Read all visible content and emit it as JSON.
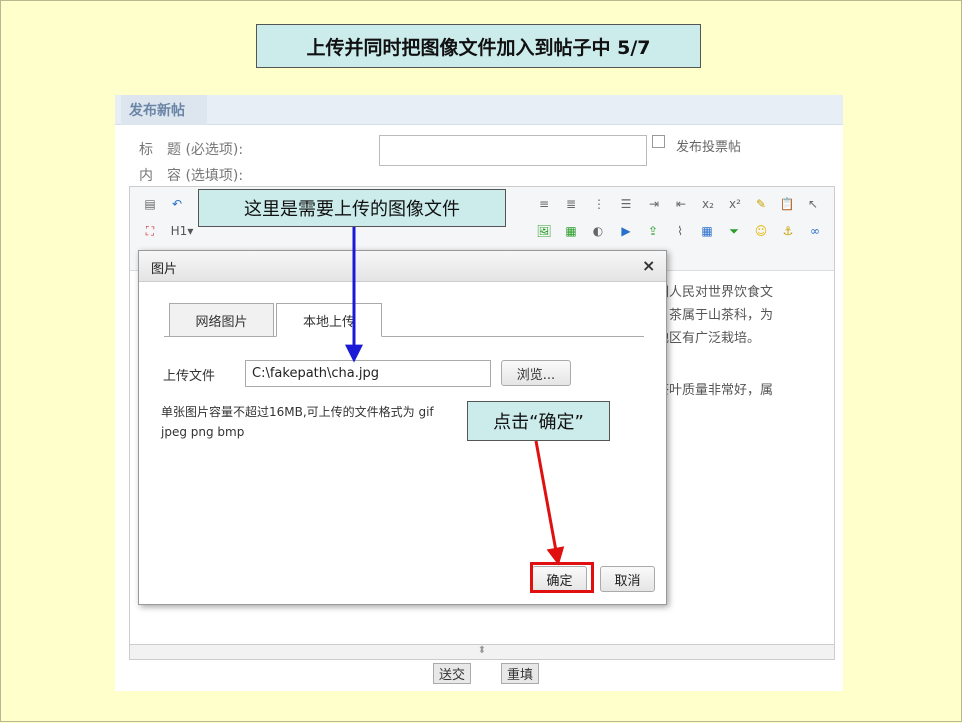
{
  "slide": {
    "title": "上传并同时把图像文件加入到帖子中 5/7",
    "callout_file": "这里是需要上传的图像文件",
    "callout_ok": "点击“确定”",
    "colors": {
      "background": "#ffffcc",
      "callout": "#ccecec",
      "upload_arrow": "#1a1ad6",
      "ok_arrow": "#e01010",
      "ok_highlight": "#e01010"
    }
  },
  "form": {
    "header": "发布新帖",
    "title_label": "标　题 (必选项):",
    "content_label": "内　容 (选填项):",
    "vote_label": "发布投票帖",
    "submit_label": "送交",
    "reset_label": "重填"
  },
  "editor": {
    "toolbar_row1": [
      "new-doc-icon",
      "undo-icon",
      "justify-icon",
      "list-icon",
      "numbered-list-icon",
      "bullet-list-icon",
      "indent-icon",
      "outdent-icon",
      "subscript-icon",
      "superscript-icon",
      "eraser-icon",
      "paste-icon",
      "cursor-icon"
    ],
    "toolbar_row2": [
      "fullscreen-icon",
      "H1",
      "font-family-icon",
      "font-size-icon",
      "font-color-icon",
      "highlight-icon",
      "bold-icon",
      "italic-icon",
      "underline-icon",
      "strikethrough-icon",
      "table-grid-icon",
      "clear-format-icon",
      "image-icon",
      "multi-image-icon",
      "flash-icon",
      "media-icon",
      "upload-icon",
      "attach-icon",
      "table-icon",
      "hr-icon",
      "emoticon-icon",
      "anchor-icon",
      "link-icon"
    ],
    "text_lines": [
      "国人民对世界饮食文",
      "。茶属于山茶科，为",
      "地区有广泛栽培。",
      "茶叶质量非常好，属"
    ]
  },
  "dialog": {
    "title": "图片",
    "close": "×",
    "tabs": [
      {
        "label": "网络图片",
        "active": false
      },
      {
        "label": "本地上传",
        "active": true
      }
    ],
    "upload_label": "上传文件",
    "file_value": "C:\\fakepath\\cha.jpg",
    "browse_label": "浏览...",
    "note_line1": "单张图片容量不超过16MB,可上传的文件格式为 gif",
    "note_line2": "jpeg png bmp",
    "ok_label": "确定",
    "cancel_label": "取消"
  }
}
